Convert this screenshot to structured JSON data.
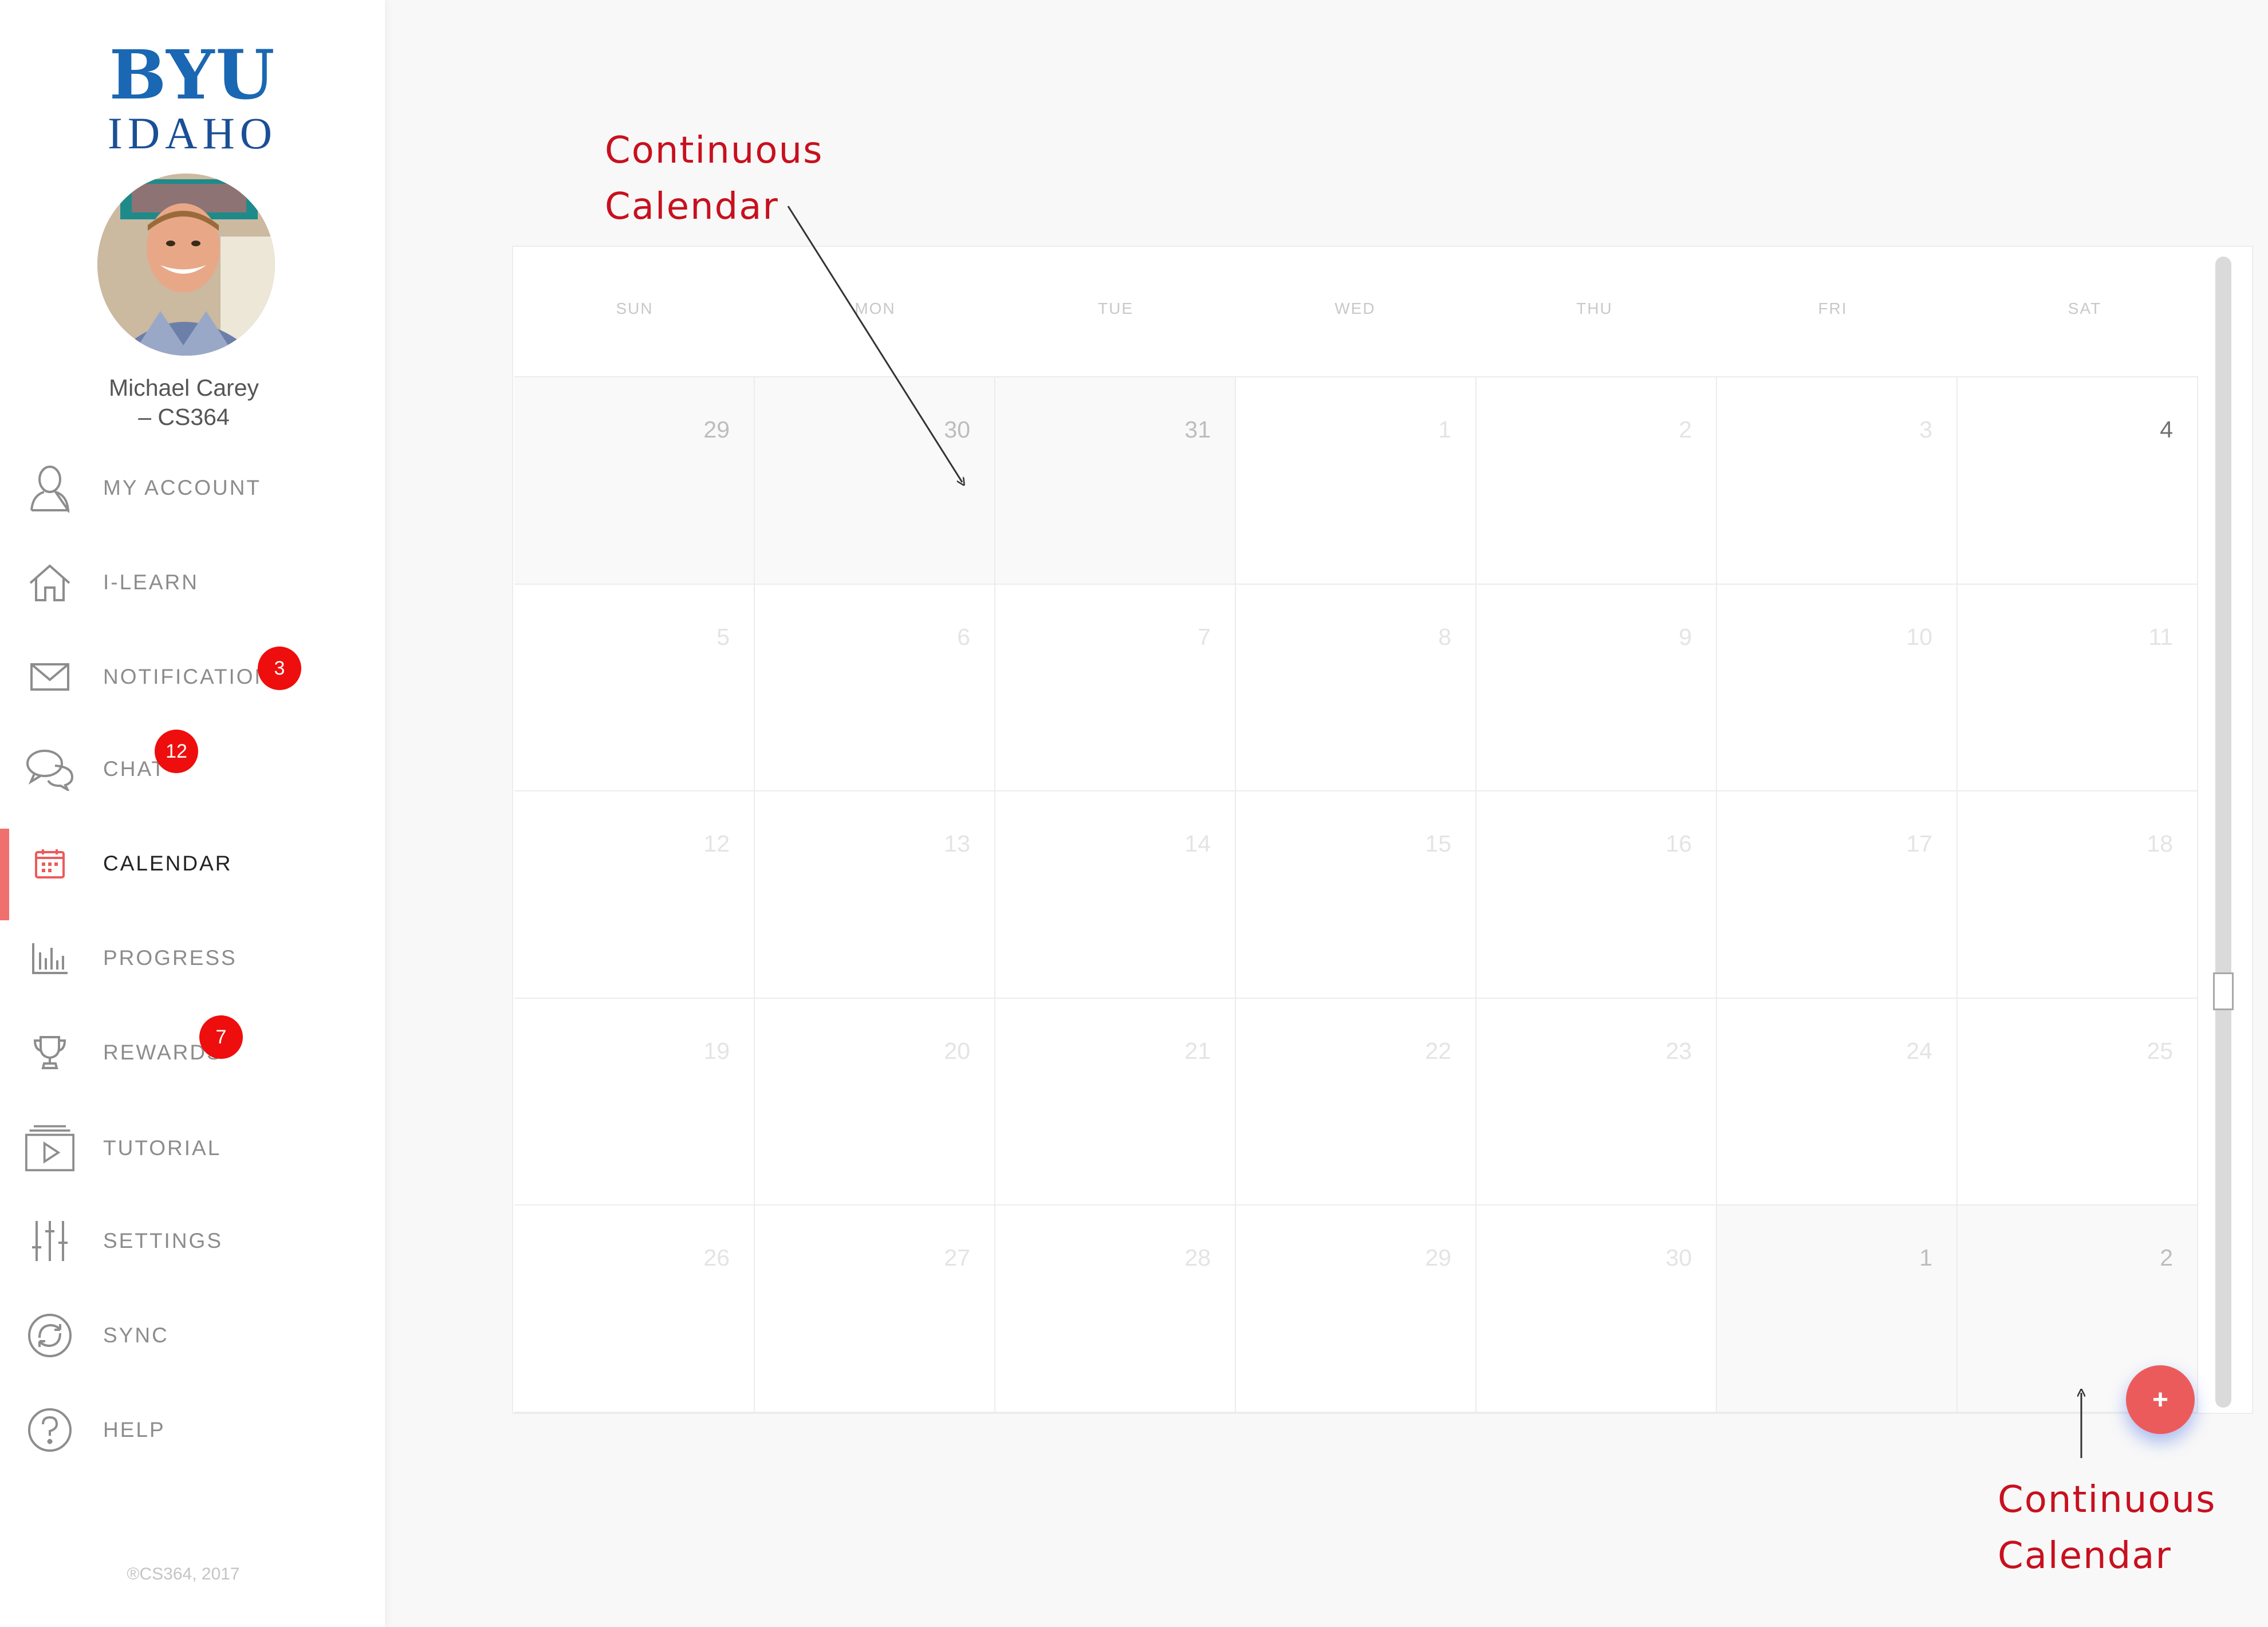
{
  "sidebar": {
    "logo": {
      "line1": "BYU",
      "line2": "IDAHO"
    },
    "user": {
      "name_line1": "Michael Carey",
      "name_line2": "– CS364"
    },
    "items": [
      {
        "label": "MY ACCOUNT",
        "icon": "user-icon",
        "active": false
      },
      {
        "label": "I-LEARN",
        "icon": "home-icon",
        "active": false
      },
      {
        "label": "NOTIFICATIONS",
        "icon": "mail-icon",
        "active": false,
        "badge": "3"
      },
      {
        "label": "CHAT",
        "icon": "chat-icon",
        "active": false,
        "badge": "12"
      },
      {
        "label": "CALENDAR",
        "icon": "calendar-icon",
        "active": true
      },
      {
        "label": "PROGRESS",
        "icon": "bar-chart-icon",
        "active": false
      },
      {
        "label": "REWARDS",
        "icon": "trophy-icon",
        "active": false,
        "badge": "7"
      },
      {
        "label": "TUTORIAL",
        "icon": "video-icon",
        "active": false
      },
      {
        "label": "SETTINGS",
        "icon": "sliders-icon",
        "active": false
      },
      {
        "label": "SYNC",
        "icon": "sync-icon",
        "active": false
      },
      {
        "label": "HELP",
        "icon": "help-icon",
        "active": false
      }
    ],
    "footer": "®CS364, 2017"
  },
  "calendar": {
    "weekdays": [
      "SUN",
      "MON",
      "TUE",
      "WED",
      "THU",
      "FRI",
      "SAT"
    ],
    "weeks": [
      [
        "29",
        "30",
        "31",
        "1",
        "2",
        "3",
        "4"
      ],
      [
        "5",
        "6",
        "7",
        "8",
        "9",
        "10",
        "11"
      ],
      [
        "12",
        "13",
        "14",
        "15",
        "16",
        "17",
        "18"
      ],
      [
        "19",
        "20",
        "21",
        "22",
        "23",
        "24",
        "25"
      ],
      [
        "26",
        "27",
        "28",
        "29",
        "30",
        "1",
        "2"
      ]
    ],
    "add_button": "+"
  },
  "annotations": {
    "top": {
      "line1": "Continuous",
      "line2": "Calendar"
    },
    "bottom": {
      "line1": "Continuous",
      "line2": "Calendar"
    }
  },
  "colors": {
    "accent": "#ec5b5b",
    "badge": "#ee0e0e",
    "annotation": "#c8101e",
    "logo_blue": "#1a67b3"
  }
}
